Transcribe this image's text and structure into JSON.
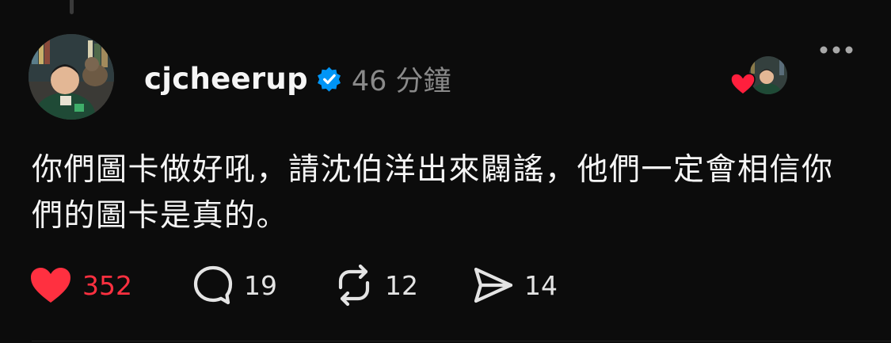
{
  "post": {
    "username": "cjcheerup",
    "time": "46 分鐘",
    "text": "你們圖卡做好吼，請沈伯洋出來闢謠，他們一定會相信你們的圖卡是真的。"
  },
  "actions": {
    "likes": "352",
    "comments": "19",
    "reposts": "12",
    "shares": "14"
  },
  "icons": {
    "verified": "verified-badge-icon",
    "like": "heart-icon",
    "comment": "comment-bubble-icon",
    "repost": "repost-icon",
    "share": "send-icon",
    "more": "more-dots-icon"
  },
  "colors": {
    "background": "#0c0c0c",
    "like_red": "#ff3040",
    "verified_blue": "#0095f6",
    "muted_text": "#8a8a8a"
  }
}
